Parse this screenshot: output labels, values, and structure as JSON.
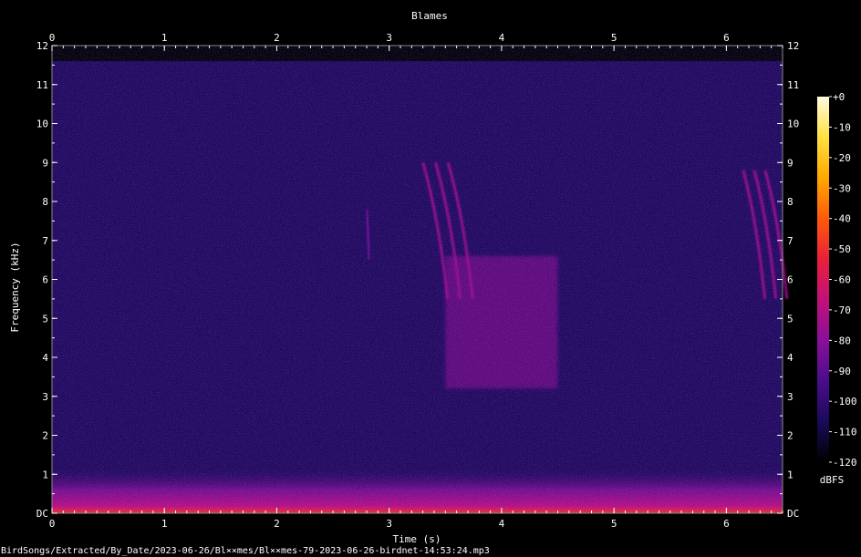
{
  "chart_data": {
    "type": "heatmap",
    "title": "Blames",
    "xlabel": "Time (s)",
    "ylabel": "Frequency (kHz)",
    "xlim": [
      0,
      6.5
    ],
    "ylim": [
      0,
      12
    ],
    "x_ticks": [
      "0",
      "1",
      "2",
      "3",
      "4",
      "5",
      "6"
    ],
    "y_ticks": [
      "DC",
      "1",
      "2",
      "3",
      "4",
      "5",
      "6",
      "7",
      "8",
      "9",
      "10",
      "11",
      "12"
    ],
    "colorbar": {
      "label": "dBFS",
      "range": [
        -120,
        0
      ],
      "ticks": [
        "+0",
        "-10",
        "-20",
        "-30",
        "-40",
        "-50",
        "-60",
        "-70",
        "-80",
        "-90",
        "-100",
        "-110",
        "-120"
      ],
      "colors": [
        "#000000",
        "#1a0a5a",
        "#4a0c8c",
        "#8a0f9a",
        "#c2107a",
        "#e8203a",
        "#ff5a0a",
        "#ffa800",
        "#ffe040",
        "#fffbe0"
      ]
    },
    "background_level_db": -105,
    "low_frequency_band": {
      "freq_khz": [
        0,
        1.2
      ],
      "level_db": -80
    },
    "events": [
      {
        "description": "downward sweep",
        "time_s": [
          3.3,
          3.7
        ],
        "freq_khz": [
          5.5,
          9.0
        ],
        "level_db": -75
      },
      {
        "description": "broadband buzz",
        "time_s": [
          3.5,
          4.5
        ],
        "freq_khz": [
          3.2,
          6.6
        ],
        "level_db": -78
      },
      {
        "description": "faint call",
        "time_s": [
          2.75,
          2.85
        ],
        "freq_khz": [
          6.5,
          7.8
        ],
        "level_db": -85
      },
      {
        "description": "downward sweep",
        "time_s": [
          6.15,
          6.5
        ],
        "freq_khz": [
          5.5,
          8.8
        ],
        "level_db": -75
      }
    ],
    "grid": false
  },
  "footer": {
    "file_path": "BirdSongs/Extracted/By_Date/2023-06-26/Bl××mes/Bl××mes-79-2023-06-26-birdnet-14:53:24.mp3"
  }
}
